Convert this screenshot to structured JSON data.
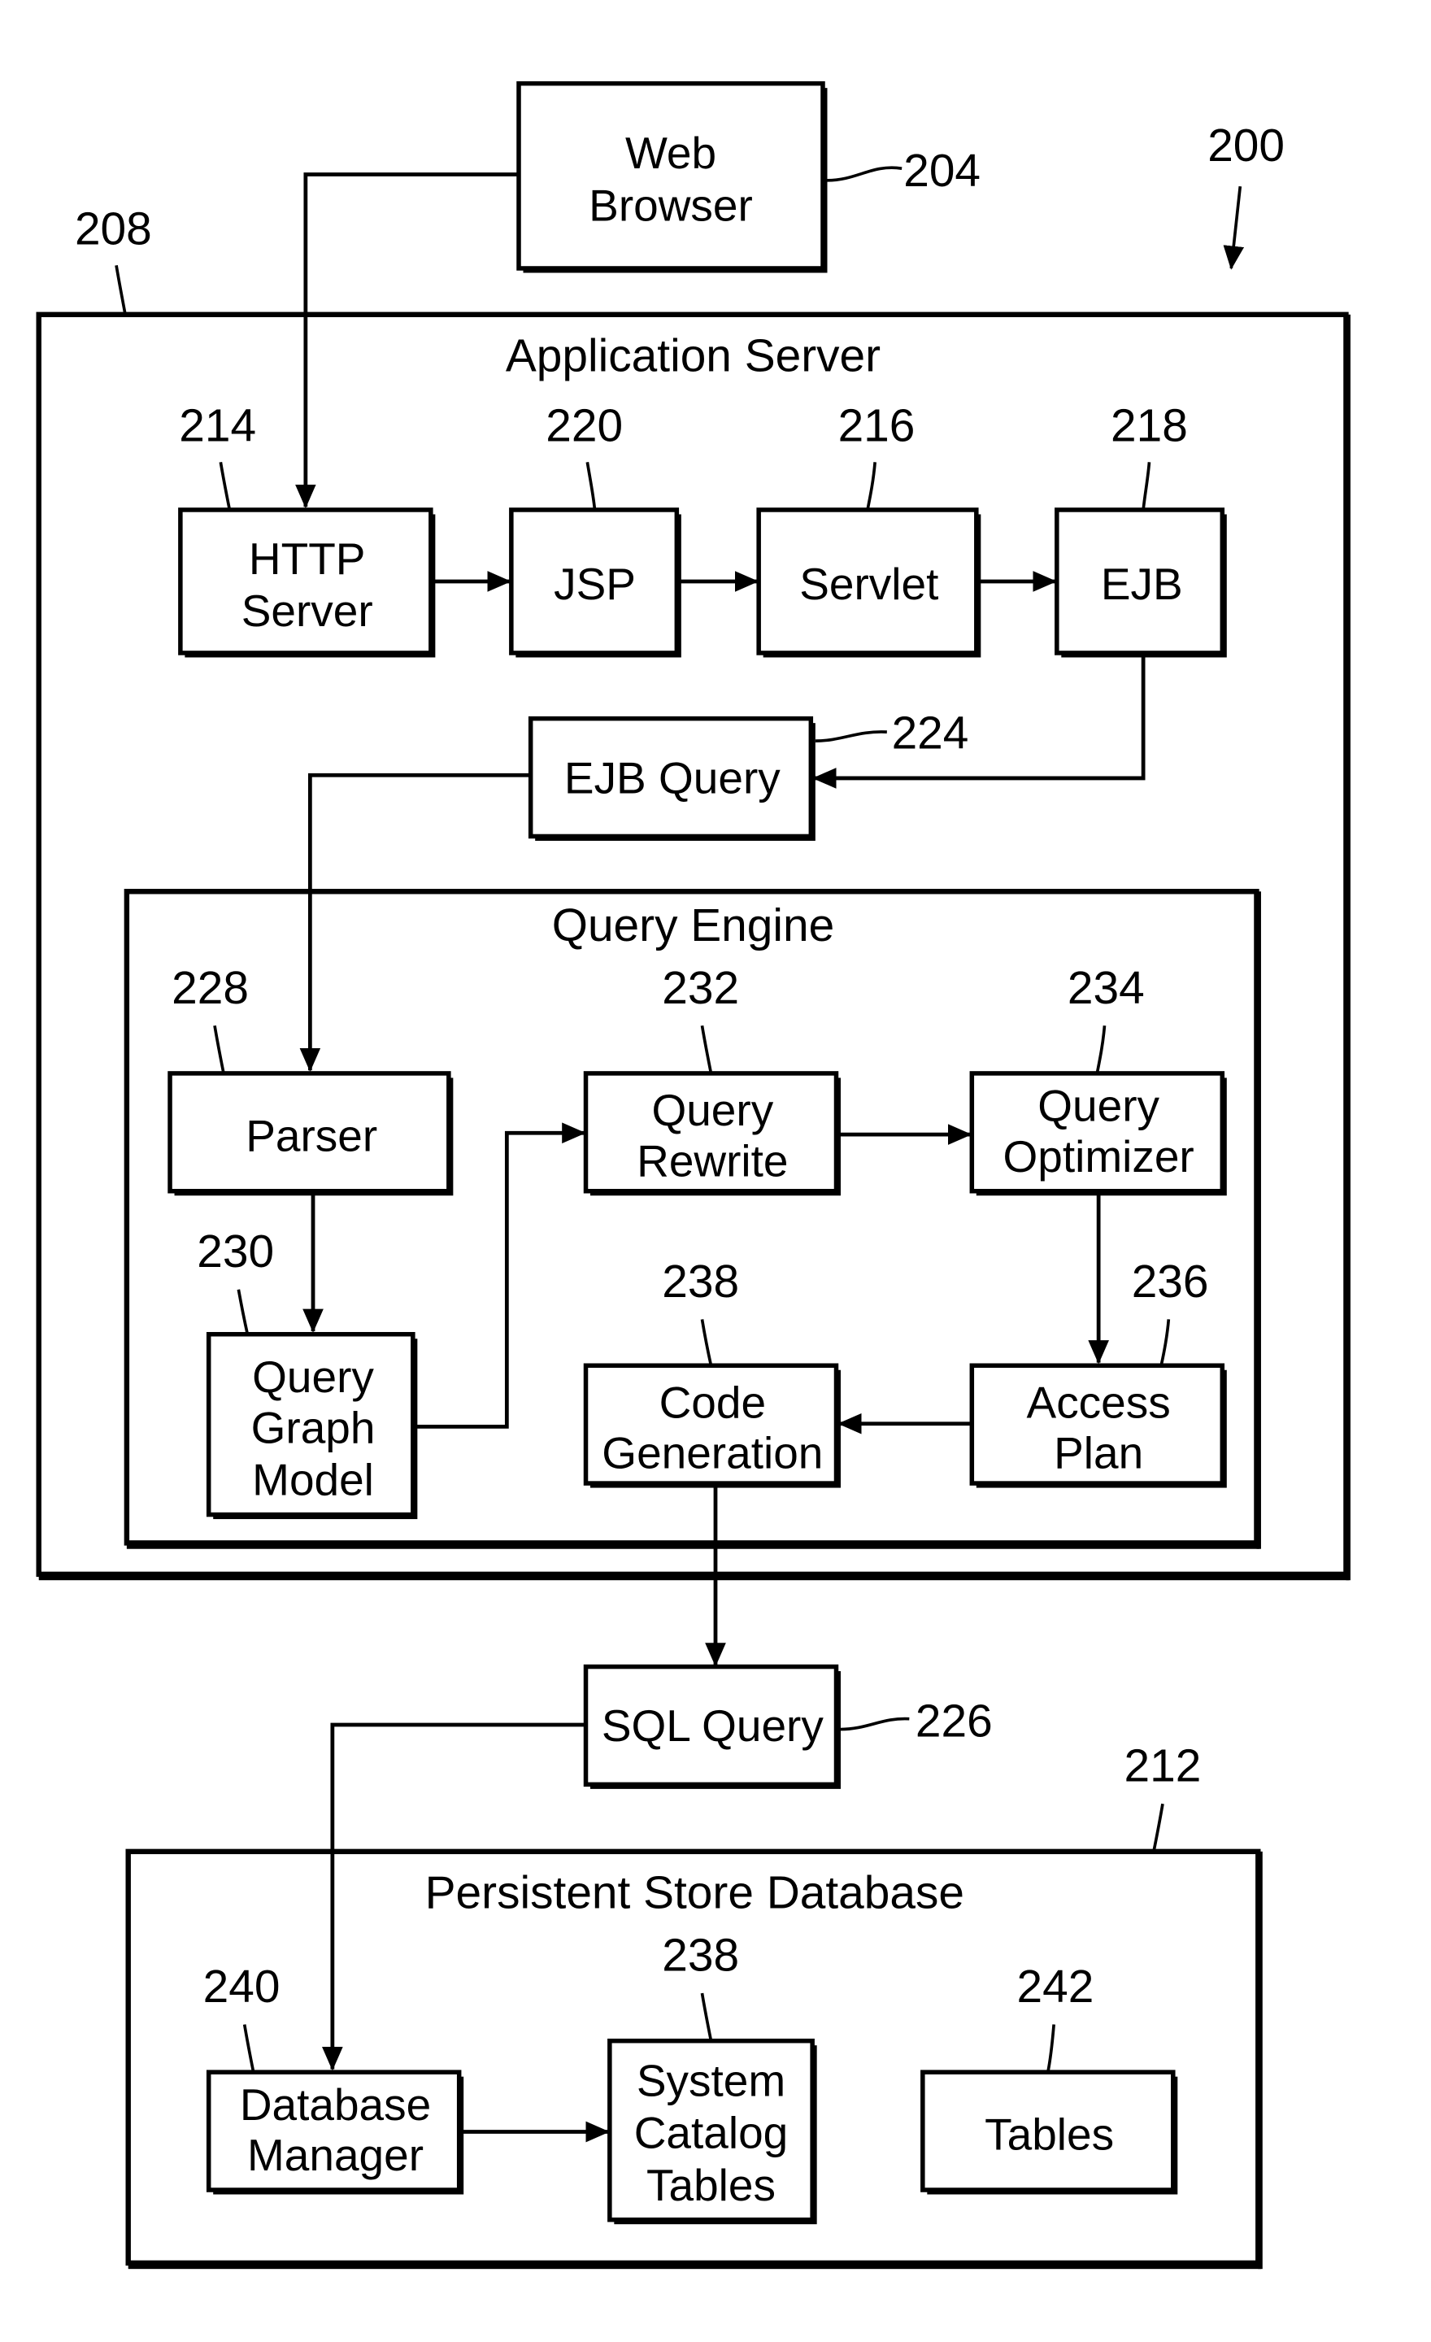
{
  "figure": {
    "ref": "200",
    "web_browser": {
      "lines": [
        "Web",
        "Browser"
      ],
      "ref": "204"
    },
    "application_server": {
      "title": "Application Server",
      "ref": "208",
      "http_server": {
        "lines": [
          "HTTP",
          "Server"
        ],
        "ref": "214"
      },
      "jsp": {
        "lines": [
          "JSP"
        ],
        "ref": "220"
      },
      "servlet": {
        "lines": [
          "Servlet"
        ],
        "ref": "216"
      },
      "ejb": {
        "lines": [
          "EJB"
        ],
        "ref": "218"
      },
      "ejb_query": {
        "lines": [
          "EJB Query"
        ],
        "ref": "224"
      },
      "query_engine": {
        "title": "Query Engine",
        "parser": {
          "lines": [
            "Parser"
          ],
          "ref": "228"
        },
        "query_graph_model": {
          "lines": [
            "Query",
            "Graph",
            "Model"
          ],
          "ref": "230"
        },
        "query_rewrite": {
          "lines": [
            "Query",
            "Rewrite"
          ],
          "ref": "232"
        },
        "query_optimizer": {
          "lines": [
            "Query",
            "Optimizer"
          ],
          "ref": "234"
        },
        "access_plan": {
          "lines": [
            "Access",
            "Plan"
          ],
          "ref": "236"
        },
        "code_generation": {
          "lines": [
            "Code",
            "Generation"
          ],
          "ref": "238"
        }
      }
    },
    "sql_query": {
      "lines": [
        "SQL Query"
      ],
      "ref": "226"
    },
    "persistent_store": {
      "title": "Persistent Store Database",
      "ref": "212",
      "database_manager": {
        "lines": [
          "Database",
          "Manager"
        ],
        "ref": "240"
      },
      "system_catalog_tables": {
        "lines": [
          "System",
          "Catalog",
          "Tables"
        ],
        "ref": "238"
      },
      "tables": {
        "lines": [
          "Tables"
        ],
        "ref": "242"
      }
    }
  }
}
